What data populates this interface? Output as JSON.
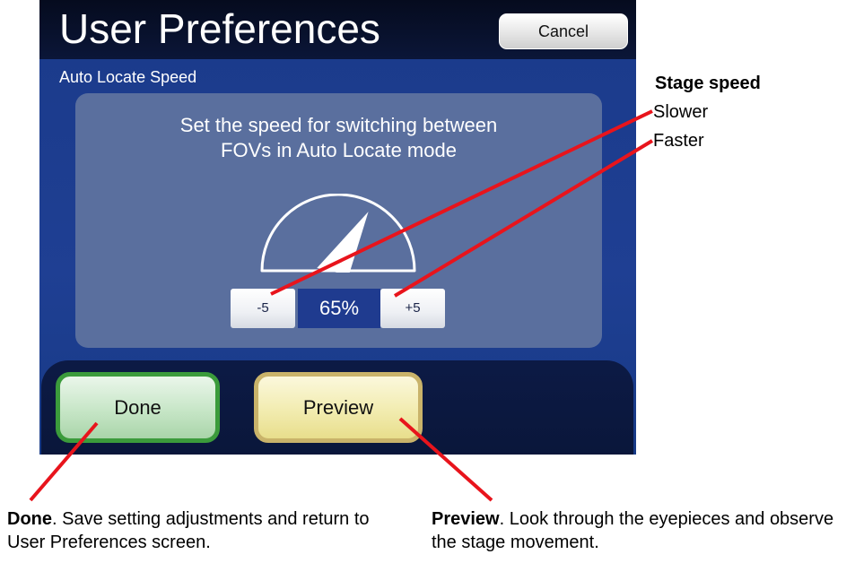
{
  "screen": {
    "title": "User Preferences",
    "cancel_label": "Cancel",
    "section_label": "Auto Locate Speed",
    "instruction_line1": "Set the speed for switching between",
    "instruction_line2": "FOVs in Auto Locate mode",
    "minus_label": "-5",
    "plus_label": "+5",
    "speed_value": "65%",
    "speed_percent": 65,
    "done_label": "Done",
    "preview_label": "Preview"
  },
  "annotations": {
    "stage_speed_title": "Stage speed",
    "slower": "Slower",
    "faster": "Faster",
    "done_bold": "Done",
    "done_text": ". Save setting adjustments and return to User Preferences screen.",
    "preview_bold": "Preview",
    "preview_text": ". Look through the eyepieces and observe the stage movement."
  },
  "colors": {
    "callout_line": "#e8141c",
    "done_border": "#3b9b3b",
    "preview_border": "#c9b36a",
    "screen_blue": "#1f3f93"
  }
}
